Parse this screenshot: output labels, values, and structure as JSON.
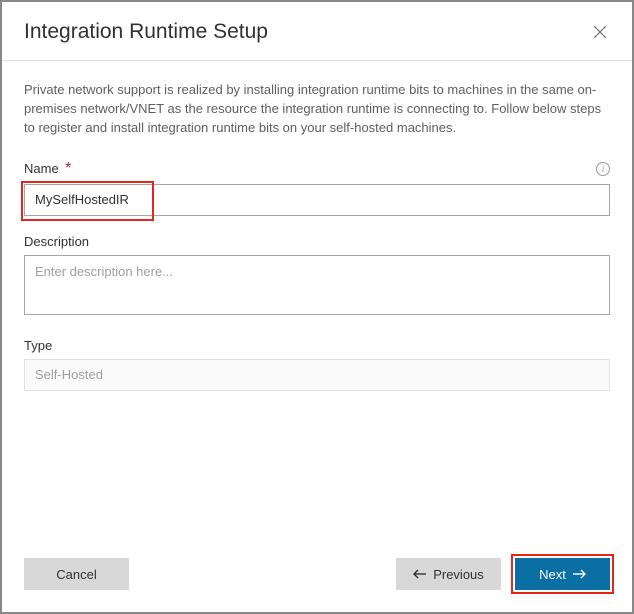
{
  "header": {
    "title": "Integration Runtime Setup"
  },
  "intro": "Private network support is realized by installing integration runtime bits to machines in the same on-premises network/VNET as the resource the integration runtime is connecting to. Follow below steps to register and install integration runtime bits on your self-hosted machines.",
  "fields": {
    "name": {
      "label": "Name",
      "value": "MySelfHostedIR"
    },
    "description": {
      "label": "Description",
      "placeholder": "Enter description here...",
      "value": ""
    },
    "type": {
      "label": "Type",
      "value": "Self-Hosted"
    }
  },
  "buttons": {
    "cancel": "Cancel",
    "previous": "Previous",
    "next": "Next"
  }
}
